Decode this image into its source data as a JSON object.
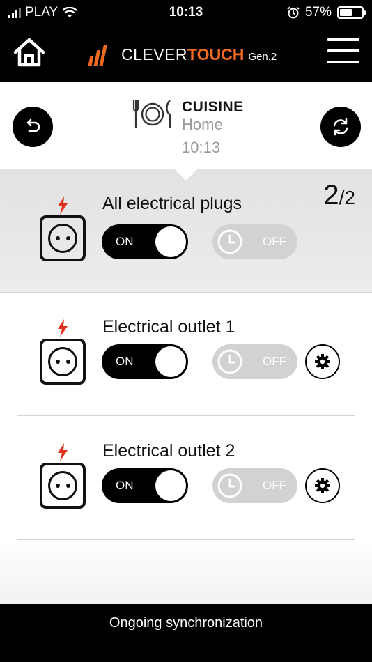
{
  "status_bar": {
    "carrier": "PLAY",
    "time": "10:13",
    "battery": "57%",
    "battery_level": 0.57
  },
  "header": {
    "brand_clever": "CLEVER",
    "brand_touch": "TOUCH",
    "brand_gen": "Gen.2"
  },
  "room": {
    "name": "CUISINE",
    "subtitle": "Home",
    "time": "10:13"
  },
  "master": {
    "label": "All electrical plugs",
    "count_on": "2",
    "count_total": "2",
    "toggle_label": "ON",
    "timer_label": "OFF"
  },
  "outlets": [
    {
      "label": "Electrical outlet 1",
      "toggle_label": "ON",
      "timer_label": "OFF"
    },
    {
      "label": "Electrical outlet 2",
      "toggle_label": "ON",
      "timer_label": "OFF"
    }
  ],
  "footer": {
    "status": "Ongoing synchronization"
  },
  "colors": {
    "brand_orange": "#f26a21",
    "bolt_red": "#e0301e",
    "header_bg": "#000000",
    "disabled_grey": "#d2d2d2"
  },
  "icons": [
    "home-icon",
    "menu-icon",
    "back-icon",
    "sync-icon",
    "dining-icon",
    "bolt-icon",
    "socket-icon",
    "clock-icon",
    "gear-icon",
    "wifi-icon",
    "alarm-icon",
    "battery-icon",
    "signal-icon"
  ]
}
